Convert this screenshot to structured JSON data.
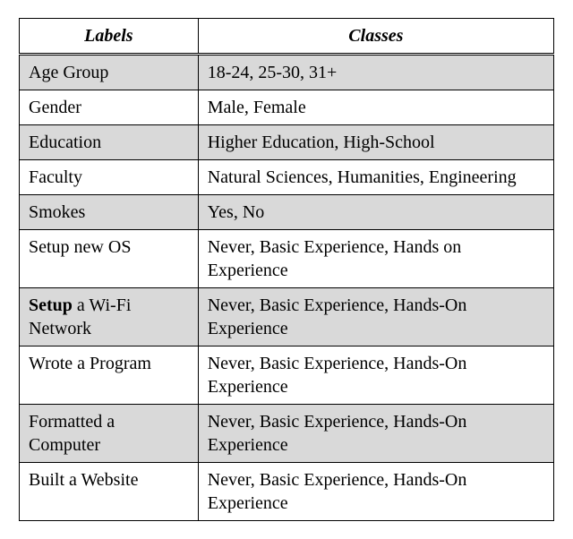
{
  "chart_data": {
    "type": "table",
    "headers": [
      "Labels",
      "Classes"
    ],
    "rows": [
      {
        "label": "Age Group",
        "classes": "18-24, 25-30, 31+",
        "shaded": true
      },
      {
        "label": "Gender",
        "classes": "Male, Female",
        "shaded": false
      },
      {
        "label": "Education",
        "classes": "Higher Education, High-School",
        "shaded": true
      },
      {
        "label": "Faculty",
        "classes": "Natural Sciences, Humanities, Engineering",
        "shaded": false
      },
      {
        "label": "Smokes",
        "classes": "Yes, No",
        "shaded": true
      },
      {
        "label": "Setup new OS",
        "classes": "Never, Basic Experience, Hands on Experience",
        "shaded": false
      },
      {
        "label": "Setup a Wi-Fi Network",
        "label_bold_prefix": "Setup",
        "classes": "Never, Basic Experience, Hands-On Experience",
        "shaded": true
      },
      {
        "label": "Wrote a Program",
        "classes": "Never, Basic Experience, Hands-On Experience",
        "shaded": false
      },
      {
        "label": "Formatted a Computer",
        "classes": "Never, Basic Experience, Hands-On Experience",
        "shaded": true
      },
      {
        "label": "Built a Website",
        "classes": "Never, Basic Experience, Hands-On Experience",
        "shaded": false
      }
    ]
  },
  "headers": {
    "labels": "Labels",
    "classes": "Classes"
  },
  "rows": {
    "r0": {
      "label": "Age Group",
      "classes": "18-24, 25-30, 31+"
    },
    "r1": {
      "label": "Gender",
      "classes": "Male, Female"
    },
    "r2": {
      "label": "Education",
      "classes": "Higher Education, High-School"
    },
    "r3": {
      "label": "Faculty",
      "classes": "Natural Sciences, Humanities, Engineering"
    },
    "r4": {
      "label": "Smokes",
      "classes": "Yes, No"
    },
    "r5": {
      "label": "Setup new OS",
      "classes": "Never, Basic Experience, Hands on Experience"
    },
    "r6": {
      "label_bold": "Setup",
      "label_rest": " a Wi-Fi Network",
      "classes": "Never, Basic Experience, Hands-On Experience"
    },
    "r7": {
      "label": "Wrote a Program",
      "classes": "Never, Basic Experience, Hands-On Experience"
    },
    "r8": {
      "label": "Formatted a Computer",
      "classes": "Never, Basic Experience, Hands-On Experience"
    },
    "r9": {
      "label": "Built a Website",
      "classes": "Never, Basic Experience, Hands-On Experience"
    }
  }
}
